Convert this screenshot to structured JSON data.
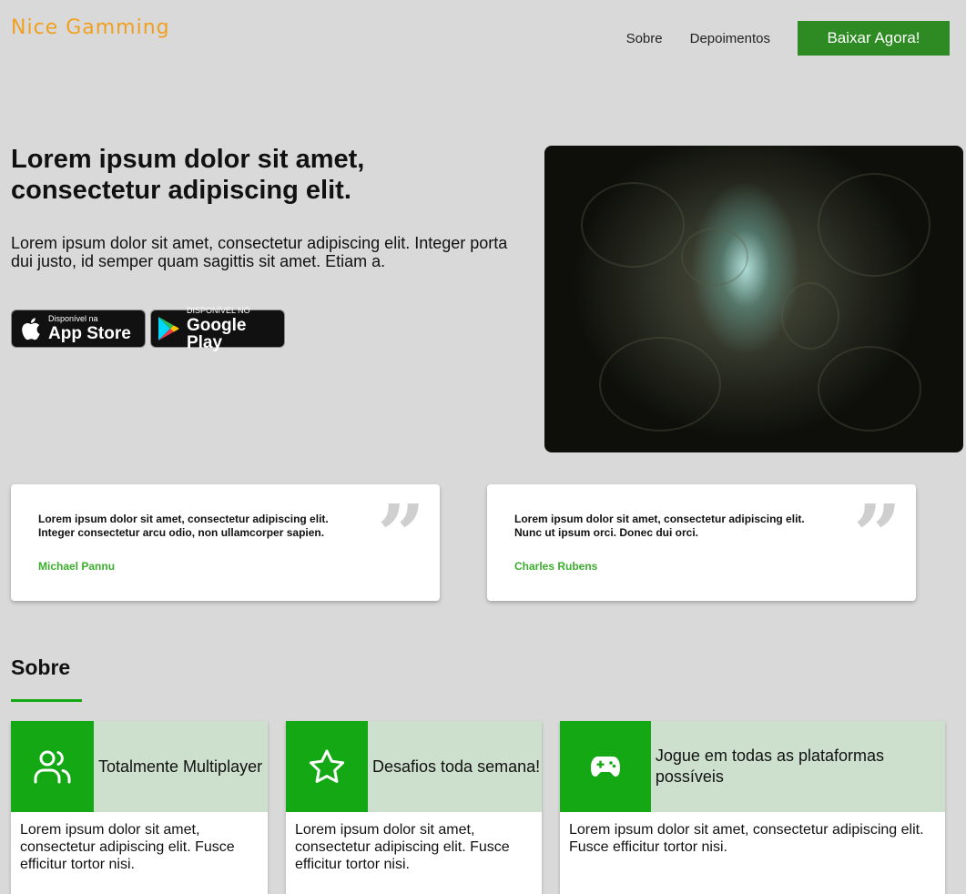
{
  "header": {
    "logo": "Nice Gamming",
    "nav": [
      "Sobre",
      "Depoimentos"
    ],
    "cta": "Baixar Agora!"
  },
  "hero": {
    "title": "Lorem ipsum dolor sit amet, consectetur adipiscing elit.",
    "text": "Lorem ipsum dolor sit amet, consectetur adipiscing elit. Integer porta dui justo, id semper quam sagittis sit amet. Etiam a.",
    "badges": [
      {
        "small": "Disponível na",
        "big": "App Store",
        "icon": "apple-icon"
      },
      {
        "small": "DISPONÍVEL NO",
        "big": "Google Play",
        "icon": "google-play-icon"
      }
    ]
  },
  "testimonials": [
    {
      "quote": "Lorem ipsum dolor sit amet, consectetur adipiscing elit. Integer consectetur arcu odio, non ullamcorper sapien.",
      "author": "Michael Pannu"
    },
    {
      "quote": "Lorem ipsum dolor sit amet, consectetur adipiscing elit. Nunc ut ipsum orci. Donec dui orci.",
      "author": "Charles Rubens"
    }
  ],
  "about": {
    "title": "Sobre",
    "features": [
      {
        "title": "Totalmente Multiplayer",
        "text": "Lorem ipsum dolor sit amet, consectetur adipiscing elit. Fusce efficitur tortor nisi.",
        "icon": "users-icon"
      },
      {
        "title": "Desafios toda semana!",
        "text": "Lorem ipsum dolor sit amet, consectetur adipiscing elit. Fusce efficitur tortor nisi.",
        "icon": "star-icon"
      },
      {
        "title": "Jogue em todas as plataformas possíveis",
        "text": "Lorem ipsum dolor sit amet, consectetur adipiscing elit. Fusce efficitur tortor nisi.",
        "icon": "gamepad-icon"
      }
    ]
  },
  "colors": {
    "background": "#d9d9d9",
    "logo": "#f0a020",
    "cta": "#2e8b23",
    "accent_green": "#14a814",
    "author_green": "#3cae2e",
    "feature_head": "#cde0cd"
  }
}
